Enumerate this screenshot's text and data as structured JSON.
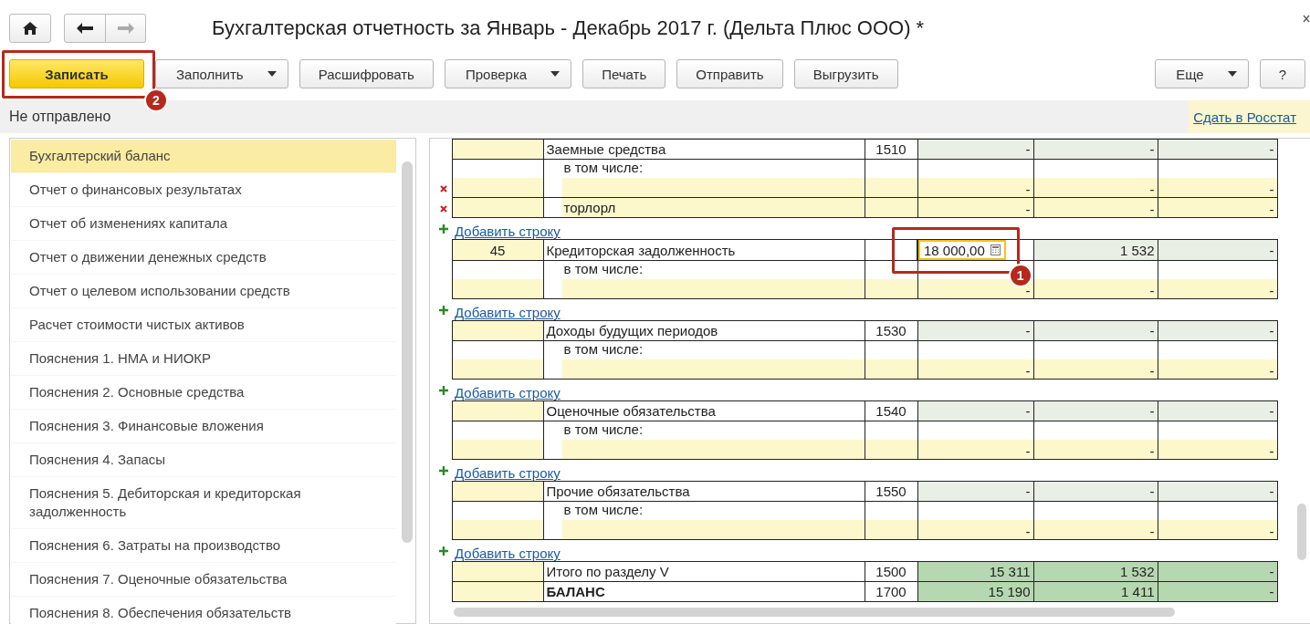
{
  "window": {
    "title": "Бухгалтерская отчетность за Январь - Декабрь 2017 г. (Дельта Плюс ООО) *"
  },
  "nav": {
    "back_disabled": false,
    "forward_disabled": true
  },
  "toolbar": [
    {
      "label": "Записать",
      "kind": "primary",
      "callout": "2"
    },
    {
      "label": "Заполнить",
      "kind": "dropdown"
    },
    {
      "label": "Расшифровать",
      "kind": "plain"
    },
    {
      "label": "Проверка",
      "kind": "dropdown"
    },
    {
      "label": "Печать",
      "kind": "plain"
    },
    {
      "label": "Отправить",
      "kind": "plain"
    },
    {
      "label": "Выгрузить",
      "kind": "plain"
    }
  ],
  "toolbar_right": [
    {
      "label": "Еще",
      "kind": "dropdown"
    },
    {
      "label": "?",
      "kind": "plain"
    }
  ],
  "status": {
    "text": "Не отправлено",
    "link": "Сдать в Росстат"
  },
  "sidebar": {
    "items": [
      {
        "label": "Бухгалтерский баланс",
        "selected": true
      },
      {
        "label": "Отчет о финансовых результатах",
        "selected": false
      },
      {
        "label": "Отчет об изменениях капитала",
        "selected": false
      },
      {
        "label": "Отчет о движении денежных средств",
        "selected": false
      },
      {
        "label": "Отчет о целевом использовании средств",
        "selected": false
      },
      {
        "label": "Расчет стоимости чистых активов",
        "selected": false
      },
      {
        "label": "Пояснения 1. НМА и НИОКР",
        "selected": false
      },
      {
        "label": "Пояснения 2. Основные средства",
        "selected": false
      },
      {
        "label": "Пояснения 3. Финансовые вложения",
        "selected": false
      },
      {
        "label": "Пояснения 4. Запасы",
        "selected": false
      },
      {
        "label": "Пояснения 5. Дебиторская и кредиторская задолженность",
        "selected": false
      },
      {
        "label": "Пояснения 6. Затраты на производство",
        "selected": false
      },
      {
        "label": "Пояснения 7. Оценочные обязательства",
        "selected": false
      },
      {
        "label": "Пояснения 8. Обеспечения обязательств",
        "selected": false
      }
    ]
  },
  "report": {
    "rows": [
      {
        "kind": "main",
        "name": "Заемные средства",
        "code": "1510",
        "values": [
          {
            "text": "-",
            "editing": false
          },
          {
            "text": "-",
            "editing": false
          },
          {
            "text": "-",
            "editing": false
          }
        ]
      },
      {
        "kind": "label",
        "name": "в том числе:"
      },
      {
        "kind": "item",
        "deletable": true,
        "name": "",
        "values": [
          "-",
          "-",
          "-"
        ]
      },
      {
        "kind": "item",
        "deletable": true,
        "name": "торлорл",
        "values": [
          "-",
          "-",
          "-"
        ]
      },
      {
        "kind": "add",
        "label": "Добавить строку"
      },
      {
        "kind": "main",
        "note": "45",
        "name": "Кредиторская задолженность",
        "values": [
          {
            "text": "18 000,00",
            "editing": true,
            "callout": "1"
          },
          {
            "text": "1 532",
            "editing": false
          },
          {
            "text": "-",
            "editing": false
          }
        ]
      },
      {
        "kind": "label",
        "name": "в том числе:"
      },
      {
        "kind": "item",
        "deletable": false,
        "name": "",
        "values": [
          "-",
          "-",
          "-"
        ]
      },
      {
        "kind": "add",
        "label": "Добавить строку"
      },
      {
        "kind": "main",
        "name": "Доходы будущих периодов",
        "code": "1530",
        "values": [
          {
            "text": "-",
            "editing": false
          },
          {
            "text": "-",
            "editing": false
          },
          {
            "text": "-",
            "editing": false
          }
        ]
      },
      {
        "kind": "label",
        "name": "в том числе:"
      },
      {
        "kind": "item",
        "deletable": false,
        "name": "",
        "values": [
          "-",
          "-",
          "-"
        ]
      },
      {
        "kind": "add",
        "label": "Добавить строку"
      },
      {
        "kind": "main",
        "name": "Оценочные обязательства",
        "code": "1540",
        "values": [
          {
            "text": "-",
            "editing": false
          },
          {
            "text": "-",
            "editing": false
          },
          {
            "text": "-",
            "editing": false
          }
        ]
      },
      {
        "kind": "label",
        "name": "в том числе:"
      },
      {
        "kind": "item",
        "deletable": false,
        "name": "",
        "values": [
          "-",
          "-",
          "-"
        ]
      },
      {
        "kind": "add",
        "label": "Добавить строку"
      },
      {
        "kind": "main",
        "name": "Прочие обязательства",
        "code": "1550",
        "values": [
          {
            "text": "-",
            "editing": false
          },
          {
            "text": "-",
            "editing": false
          },
          {
            "text": "-",
            "editing": false
          }
        ]
      },
      {
        "kind": "label",
        "name": "в том числе:"
      },
      {
        "kind": "item",
        "deletable": false,
        "name": "",
        "values": [
          "-",
          "-",
          "-"
        ]
      },
      {
        "kind": "add",
        "label": "Добавить строку"
      },
      {
        "kind": "total",
        "bold": false,
        "name": "Итого по разделу V",
        "code": "1500",
        "values": [
          {
            "text": "15 311",
            "editing": false
          },
          {
            "text": "1 532",
            "editing": false
          },
          {
            "text": "-",
            "editing": false
          }
        ]
      },
      {
        "kind": "total",
        "bold": true,
        "name": "БАЛАНС",
        "code": "1700",
        "values": [
          {
            "text": "15 190",
            "editing": false
          },
          {
            "text": "1 411",
            "editing": false
          },
          {
            "text": "-",
            "editing": false
          }
        ]
      }
    ]
  }
}
